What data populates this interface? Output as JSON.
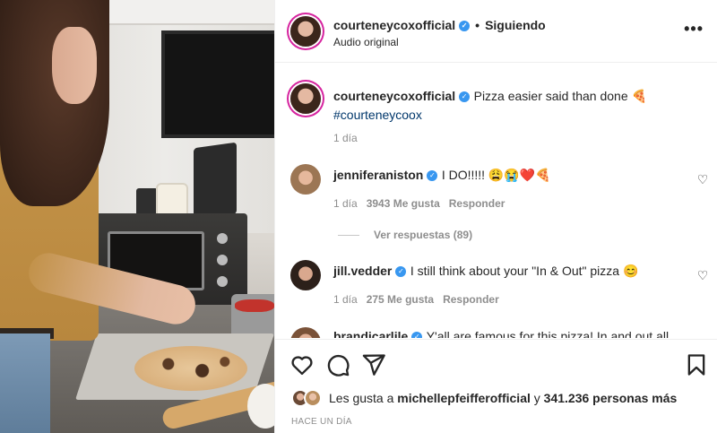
{
  "header": {
    "username": "courteneycoxofficial",
    "separator": "•",
    "follow_status": "Siguiendo",
    "audio": "Audio original",
    "more_icon": "more-horizontal-icon"
  },
  "caption": {
    "username": "courteneycoxofficial",
    "text": "Pizza easier said than done 🍕",
    "hashtag": "#courteneycoox",
    "time": "1 día"
  },
  "comments": [
    {
      "username": "jenniferaniston",
      "text": "I DO!!!!! 😩😭❤️🍕",
      "time": "1 día",
      "likes": "3943 Me gusta",
      "reply": "Responder"
    },
    {
      "username": "jill.vedder",
      "text": "I still think about your \"In & Out\" pizza 😊",
      "time": "1 día",
      "likes": "275 Me gusta",
      "reply": "Responder"
    },
    {
      "username": "brandicarlile",
      "text": "Y'all are famous for this pizza! In and out all"
    }
  ],
  "view_replies": "Ver respuestas (89)",
  "actions": {
    "like_icon": "heart-icon",
    "comment_icon": "comment-icon",
    "share_icon": "send-icon",
    "save_icon": "bookmark-icon"
  },
  "likes": {
    "prefix": "Les gusta a",
    "user": "michellepfeifferofficial",
    "and": "y",
    "count": "341.236 personas más"
  },
  "time_ago": "HACE UN DÍA",
  "colors": {
    "verified": "#3897f0",
    "hashtag": "#00376b",
    "muted": "#8e8e8e"
  }
}
